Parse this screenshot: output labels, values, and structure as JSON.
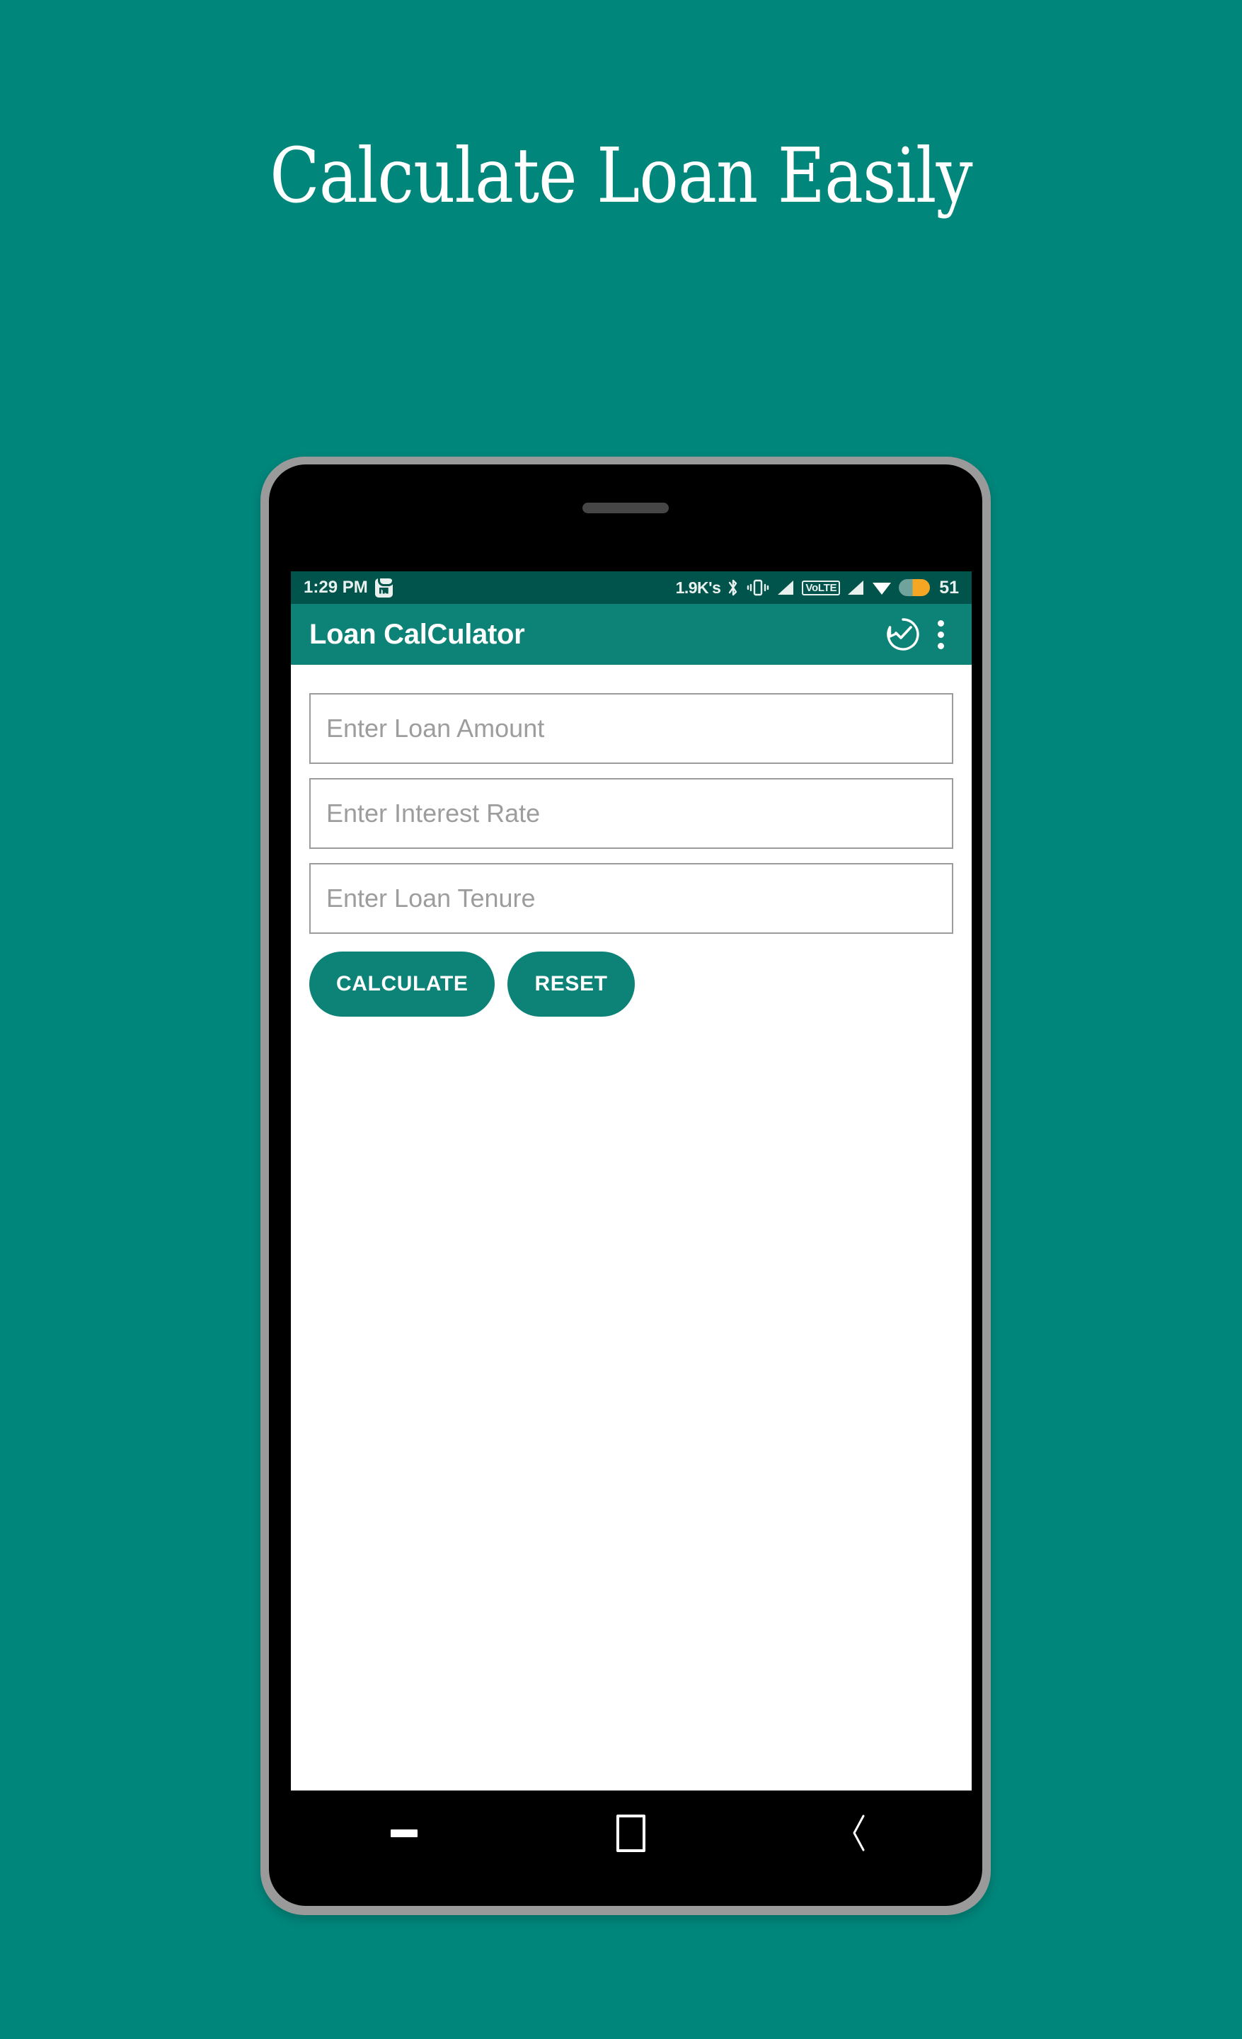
{
  "promo": {
    "heading": "Calculate Loan Easily",
    "background_color": "#00867B"
  },
  "phone": {
    "frame_color": "#9a9a9a",
    "body_color": "#000000"
  },
  "status_bar": {
    "background_color": "#00544C",
    "time": "1:29 PM",
    "mi_icon": "mi-store-icon",
    "data_rate": "1.9K's",
    "bluetooth_icon": "bluetooth-icon",
    "vibrate_icon": "vibrate-icon",
    "signal_icon_1": "signal-bars-icon",
    "volte_label": "VoLTE",
    "signal_icon_2": "signal-bars-icon",
    "wifi_icon": "wifi-icon",
    "battery_icon": "battery-icon",
    "battery_level": "51"
  },
  "app_bar": {
    "background_color": "#0D8377",
    "title": "Loan CalCulator",
    "history_icon": "update-check-icon",
    "overflow_icon": "overflow-menu-icon"
  },
  "form": {
    "fields": [
      {
        "name": "loan-amount",
        "placeholder": "Enter Loan Amount",
        "value": ""
      },
      {
        "name": "interest-rate",
        "placeholder": "Enter Interest Rate",
        "value": ""
      },
      {
        "name": "loan-tenure",
        "placeholder": "Enter Loan Tenure",
        "value": ""
      }
    ],
    "buttons": {
      "calculate_label": "CALCULATE",
      "reset_label": "RESET",
      "color": "#0D8377"
    }
  },
  "nav_bar": {
    "recents_icon": "recents-dash-icon",
    "home_icon": "home-square-icon",
    "back_icon": "back-chevron-icon"
  }
}
